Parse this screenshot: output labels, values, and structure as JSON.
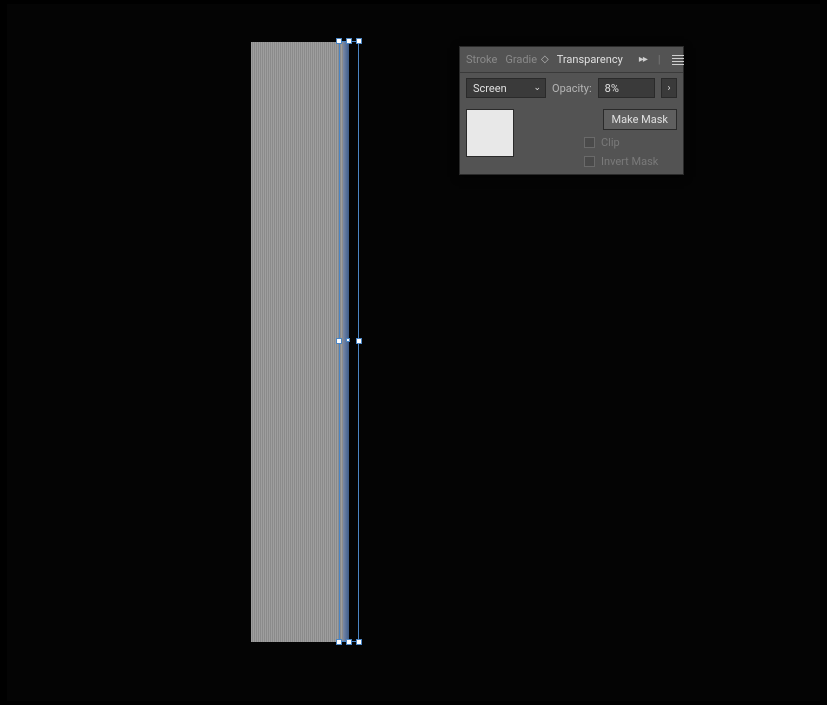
{
  "panel": {
    "tabs": {
      "stroke": "Stroke",
      "gradient": "Gradie",
      "transparency": "Transparency"
    },
    "blend_mode": "Screen",
    "opacity_label": "Opacity:",
    "opacity_value": "8%",
    "make_mask_label": "Make Mask",
    "clip_label": "Clip",
    "invert_mask_label": "Invert Mask"
  }
}
